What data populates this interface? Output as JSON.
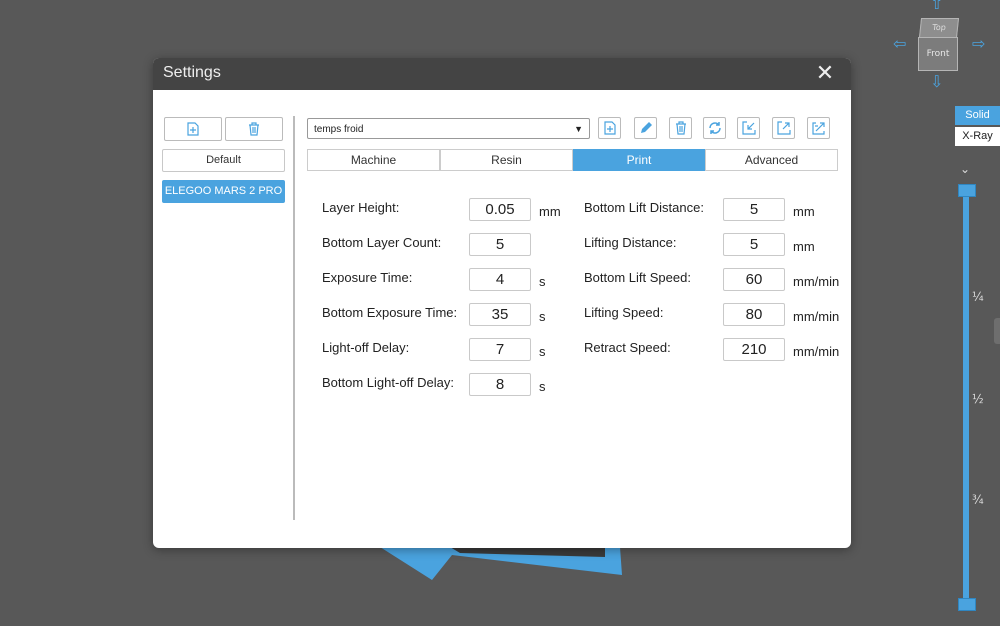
{
  "dialog": {
    "title": "Settings",
    "close_icon": "close-icon"
  },
  "left_panel": {
    "add_icon": "add-file-icon",
    "delete_icon": "trash-icon",
    "presets": [
      "Default",
      "ELEGOO MARS 2 PRO"
    ],
    "selected_preset": "ELEGOO MARS 2 PRO"
  },
  "profile": {
    "selected": "temps froid",
    "toolbar_icons": [
      "new-profile-icon",
      "edit-icon",
      "delete-icon",
      "refresh-icon",
      "import-icon",
      "export-icon",
      "export-all-icon"
    ]
  },
  "tabs": [
    "Machine",
    "Resin",
    "Print",
    "Advanced"
  ],
  "active_tab": "Print",
  "fields_left": [
    {
      "label": "Layer Height:",
      "value": "0.05",
      "unit": "mm"
    },
    {
      "label": "Bottom Layer Count:",
      "value": "5",
      "unit": ""
    },
    {
      "label": "Exposure Time:",
      "value": "4",
      "unit": "s"
    },
    {
      "label": "Bottom Exposure Time:",
      "value": "35",
      "unit": "s"
    },
    {
      "label": "Light-off Delay:",
      "value": "7",
      "unit": "s"
    },
    {
      "label": "Bottom Light-off Delay:",
      "value": "8",
      "unit": "s"
    }
  ],
  "fields_right": [
    {
      "label": "Bottom Lift Distance:",
      "value": "5",
      "unit": "mm"
    },
    {
      "label": "Lifting Distance:",
      "value": "5",
      "unit": "mm"
    },
    {
      "label": "Bottom Lift Speed:",
      "value": "60",
      "unit": "mm/min"
    },
    {
      "label": "Lifting Speed:",
      "value": "80",
      "unit": "mm/min"
    },
    {
      "label": "Retract Speed:",
      "value": "210",
      "unit": "mm/min"
    }
  ],
  "view_cube": {
    "top": "Top",
    "front": "Front"
  },
  "render_modes": [
    "Solid",
    "X-Ray"
  ],
  "active_render_mode": "Solid",
  "layer_slider": {
    "marks": [
      "¼",
      "½",
      "¾"
    ]
  },
  "colors": {
    "accent": "#4aa3df",
    "titlebar": "#444444",
    "background": "#585858"
  }
}
